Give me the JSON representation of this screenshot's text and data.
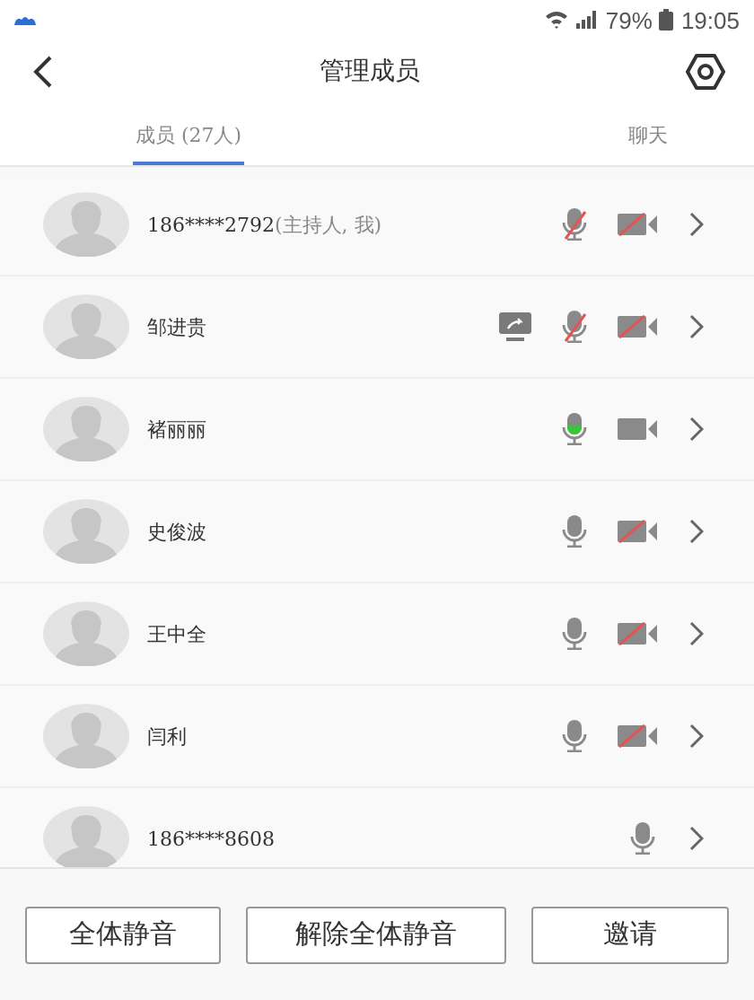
{
  "status_bar": {
    "battery": "79%",
    "time": "19:05"
  },
  "header": {
    "title": "管理成员"
  },
  "tabs": [
    {
      "label": "成员 (27人)",
      "selected": true
    },
    {
      "label": "聊天",
      "selected": false
    }
  ],
  "members": [
    {
      "name": "186****2792",
      "role": "(主持人, 我)",
      "sharing": false,
      "mic_muted": true,
      "speaking": false,
      "camera_off": true
    },
    {
      "name": "邹进贵",
      "sharing": true,
      "mic_muted": true,
      "speaking": false,
      "camera_off": true
    },
    {
      "name": "褚丽丽",
      "sharing": false,
      "mic_muted": false,
      "speaking": true,
      "camera_off": false
    },
    {
      "name": "史俊波",
      "sharing": false,
      "mic_muted": false,
      "speaking": false,
      "camera_off": true
    },
    {
      "name": "王中全",
      "sharing": false,
      "mic_muted": false,
      "speaking": false,
      "camera_off": true
    },
    {
      "name": "闫利",
      "sharing": false,
      "mic_muted": false,
      "speaking": false,
      "camera_off": true
    },
    {
      "name": "186****8608",
      "sharing": false,
      "mic_muted": false,
      "speaking": false
    }
  ],
  "buttons": [
    "全体静音",
    "解除全体静音",
    "邀请"
  ]
}
